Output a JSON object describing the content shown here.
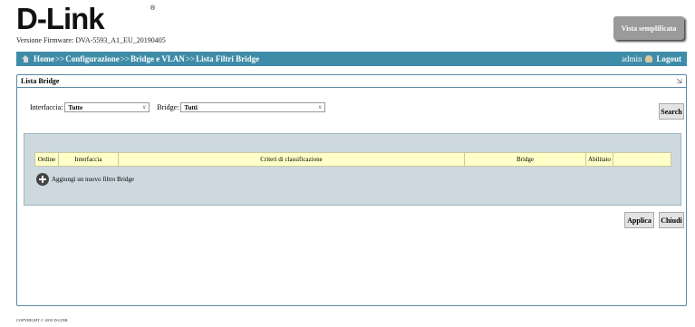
{
  "header": {
    "logo": "D-Link",
    "logo_reg": "®",
    "firmware": "Versione Firmware: DVA-5593_A1_EU_20190405",
    "simple_view_button": "Vista semplificata"
  },
  "nav": {
    "home": "Home",
    "sep": ">>",
    "config": "Configurazione",
    "bridge_vlan": "Bridge e VLAN",
    "current": "Lista Filtri Bridge",
    "user": "admin",
    "logout": "Logout"
  },
  "panel": {
    "title": "Lista Bridge",
    "interface_label": "Interfaccia:",
    "interface_value": "Tutte",
    "bridge_label": "Bridge:",
    "bridge_value": "Tutti",
    "search": "Search"
  },
  "table": {
    "columns": [
      "Ordine",
      "Interfaccia",
      "Criteri di classificazione",
      "Bridge",
      "Abilitato",
      ""
    ]
  },
  "add_filter": "Aggiungi un nuovo filtro Bridge",
  "buttons": {
    "apply": "Applica",
    "close": "Chiudi"
  },
  "footer": {
    "copyright": "COPYRIGHT © 2019 D-LINK"
  }
}
